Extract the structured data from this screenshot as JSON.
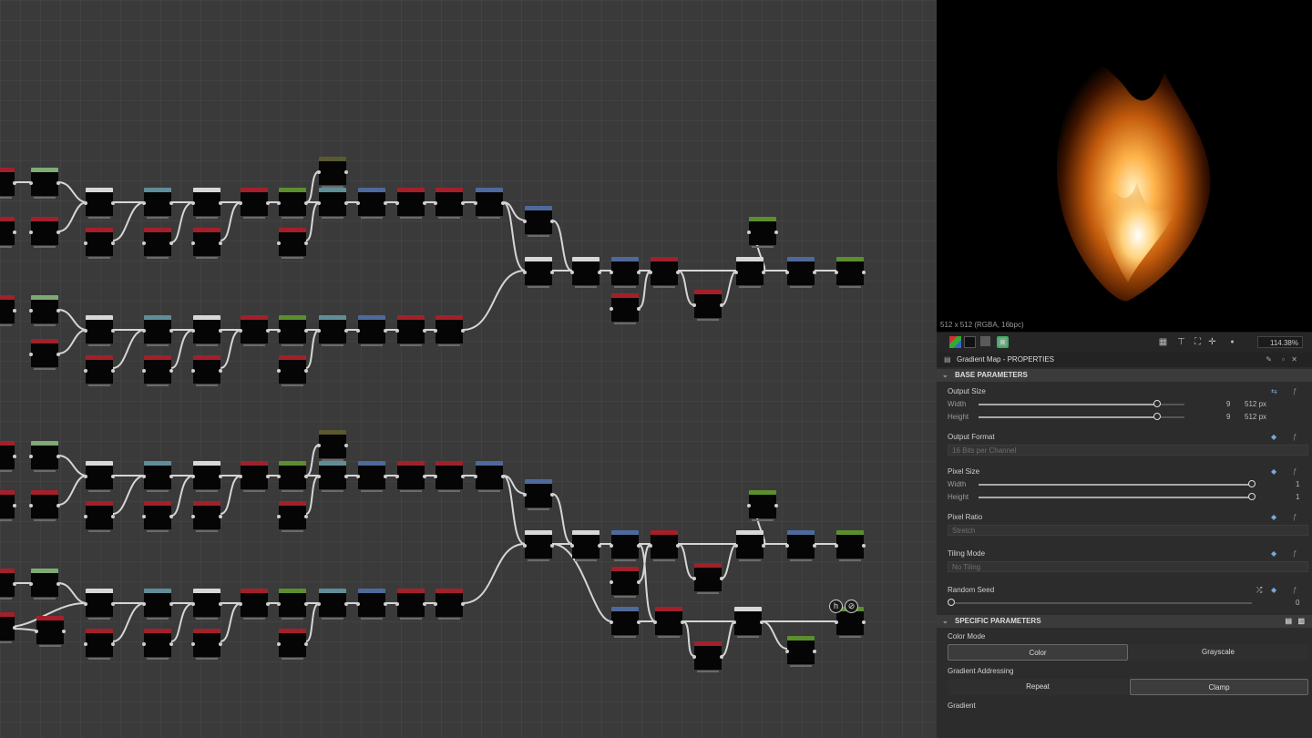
{
  "preview": {
    "caption": "512 x 512 (RGBA, 16bpc)",
    "zoom": "114.38%"
  },
  "properties": {
    "title": "Gradient Map - PROPERTIES",
    "base_section": "BASE PARAMETERS",
    "output_size": {
      "label": "Output Size",
      "width_label": "Width",
      "height_label": "Height",
      "width_value": "9",
      "height_value": "9",
      "width_unit": "512 px",
      "height_unit": "512 px"
    },
    "output_format": {
      "label": "Output Format",
      "value": "16 Bits per Channel"
    },
    "pixel_size": {
      "label": "Pixel Size",
      "width_label": "Width",
      "height_label": "Height",
      "width_value": "1",
      "height_value": "1"
    },
    "pixel_ratio": {
      "label": "Pixel Ratio",
      "value": "Stretch"
    },
    "tiling_mode": {
      "label": "Tiling Mode",
      "value": "No Tiling"
    },
    "random_seed": {
      "label": "Random Seed",
      "value": "0"
    },
    "specific_section": "SPECIFIC PARAMETERS",
    "color_mode": {
      "label": "Color Mode",
      "options": [
        "Color",
        "Grayscale"
      ],
      "selected": "Color"
    },
    "gradient_addressing": {
      "label": "Gradient Addressing",
      "options": [
        "Repeat",
        "Clamp"
      ],
      "selected": "Clamp"
    },
    "gradient_label": "Gradient"
  },
  "graph": {
    "badges": [
      "h",
      "⊘"
    ],
    "accent_colors": {
      "white": "#d8d8d8",
      "red": "#a3202a",
      "teal": "#5f8e98",
      "blue": "#4e6a9c",
      "green": "#5b8f2e",
      "olive": "#5a5930",
      "light_green": "#7faa74"
    }
  }
}
